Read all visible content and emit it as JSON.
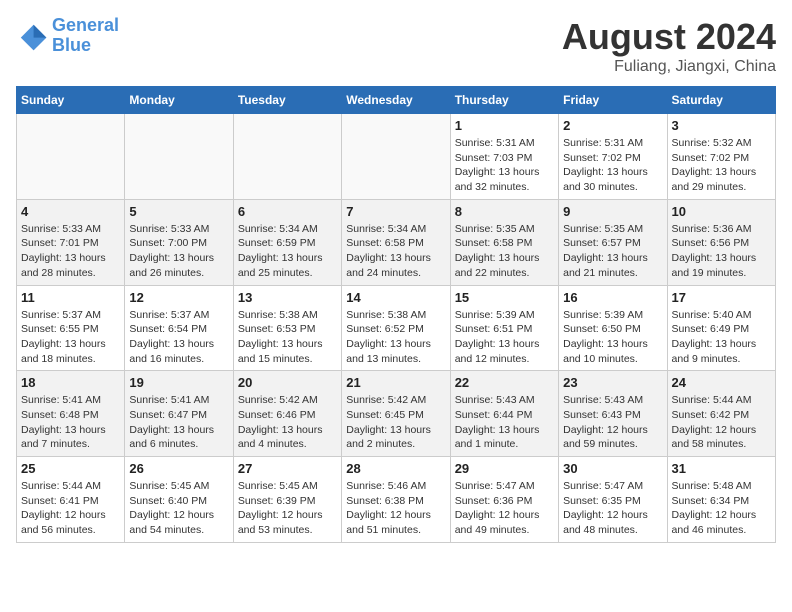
{
  "header": {
    "logo_line1": "General",
    "logo_line2": "Blue",
    "month_year": "August 2024",
    "location": "Fuliang, Jiangxi, China"
  },
  "weekdays": [
    "Sunday",
    "Monday",
    "Tuesday",
    "Wednesday",
    "Thursday",
    "Friday",
    "Saturday"
  ],
  "weeks": [
    [
      {
        "day": "",
        "info": ""
      },
      {
        "day": "",
        "info": ""
      },
      {
        "day": "",
        "info": ""
      },
      {
        "day": "",
        "info": ""
      },
      {
        "day": "1",
        "info": "Sunrise: 5:31 AM\nSunset: 7:03 PM\nDaylight: 13 hours\nand 32 minutes."
      },
      {
        "day": "2",
        "info": "Sunrise: 5:31 AM\nSunset: 7:02 PM\nDaylight: 13 hours\nand 30 minutes."
      },
      {
        "day": "3",
        "info": "Sunrise: 5:32 AM\nSunset: 7:02 PM\nDaylight: 13 hours\nand 29 minutes."
      }
    ],
    [
      {
        "day": "4",
        "info": "Sunrise: 5:33 AM\nSunset: 7:01 PM\nDaylight: 13 hours\nand 28 minutes."
      },
      {
        "day": "5",
        "info": "Sunrise: 5:33 AM\nSunset: 7:00 PM\nDaylight: 13 hours\nand 26 minutes."
      },
      {
        "day": "6",
        "info": "Sunrise: 5:34 AM\nSunset: 6:59 PM\nDaylight: 13 hours\nand 25 minutes."
      },
      {
        "day": "7",
        "info": "Sunrise: 5:34 AM\nSunset: 6:58 PM\nDaylight: 13 hours\nand 24 minutes."
      },
      {
        "day": "8",
        "info": "Sunrise: 5:35 AM\nSunset: 6:58 PM\nDaylight: 13 hours\nand 22 minutes."
      },
      {
        "day": "9",
        "info": "Sunrise: 5:35 AM\nSunset: 6:57 PM\nDaylight: 13 hours\nand 21 minutes."
      },
      {
        "day": "10",
        "info": "Sunrise: 5:36 AM\nSunset: 6:56 PM\nDaylight: 13 hours\nand 19 minutes."
      }
    ],
    [
      {
        "day": "11",
        "info": "Sunrise: 5:37 AM\nSunset: 6:55 PM\nDaylight: 13 hours\nand 18 minutes."
      },
      {
        "day": "12",
        "info": "Sunrise: 5:37 AM\nSunset: 6:54 PM\nDaylight: 13 hours\nand 16 minutes."
      },
      {
        "day": "13",
        "info": "Sunrise: 5:38 AM\nSunset: 6:53 PM\nDaylight: 13 hours\nand 15 minutes."
      },
      {
        "day": "14",
        "info": "Sunrise: 5:38 AM\nSunset: 6:52 PM\nDaylight: 13 hours\nand 13 minutes."
      },
      {
        "day": "15",
        "info": "Sunrise: 5:39 AM\nSunset: 6:51 PM\nDaylight: 13 hours\nand 12 minutes."
      },
      {
        "day": "16",
        "info": "Sunrise: 5:39 AM\nSunset: 6:50 PM\nDaylight: 13 hours\nand 10 minutes."
      },
      {
        "day": "17",
        "info": "Sunrise: 5:40 AM\nSunset: 6:49 PM\nDaylight: 13 hours\nand 9 minutes."
      }
    ],
    [
      {
        "day": "18",
        "info": "Sunrise: 5:41 AM\nSunset: 6:48 PM\nDaylight: 13 hours\nand 7 minutes."
      },
      {
        "day": "19",
        "info": "Sunrise: 5:41 AM\nSunset: 6:47 PM\nDaylight: 13 hours\nand 6 minutes."
      },
      {
        "day": "20",
        "info": "Sunrise: 5:42 AM\nSunset: 6:46 PM\nDaylight: 13 hours\nand 4 minutes."
      },
      {
        "day": "21",
        "info": "Sunrise: 5:42 AM\nSunset: 6:45 PM\nDaylight: 13 hours\nand 2 minutes."
      },
      {
        "day": "22",
        "info": "Sunrise: 5:43 AM\nSunset: 6:44 PM\nDaylight: 13 hours\nand 1 minute."
      },
      {
        "day": "23",
        "info": "Sunrise: 5:43 AM\nSunset: 6:43 PM\nDaylight: 12 hours\nand 59 minutes."
      },
      {
        "day": "24",
        "info": "Sunrise: 5:44 AM\nSunset: 6:42 PM\nDaylight: 12 hours\nand 58 minutes."
      }
    ],
    [
      {
        "day": "25",
        "info": "Sunrise: 5:44 AM\nSunset: 6:41 PM\nDaylight: 12 hours\nand 56 minutes."
      },
      {
        "day": "26",
        "info": "Sunrise: 5:45 AM\nSunset: 6:40 PM\nDaylight: 12 hours\nand 54 minutes."
      },
      {
        "day": "27",
        "info": "Sunrise: 5:45 AM\nSunset: 6:39 PM\nDaylight: 12 hours\nand 53 minutes."
      },
      {
        "day": "28",
        "info": "Sunrise: 5:46 AM\nSunset: 6:38 PM\nDaylight: 12 hours\nand 51 minutes."
      },
      {
        "day": "29",
        "info": "Sunrise: 5:47 AM\nSunset: 6:36 PM\nDaylight: 12 hours\nand 49 minutes."
      },
      {
        "day": "30",
        "info": "Sunrise: 5:47 AM\nSunset: 6:35 PM\nDaylight: 12 hours\nand 48 minutes."
      },
      {
        "day": "31",
        "info": "Sunrise: 5:48 AM\nSunset: 6:34 PM\nDaylight: 12 hours\nand 46 minutes."
      }
    ]
  ]
}
